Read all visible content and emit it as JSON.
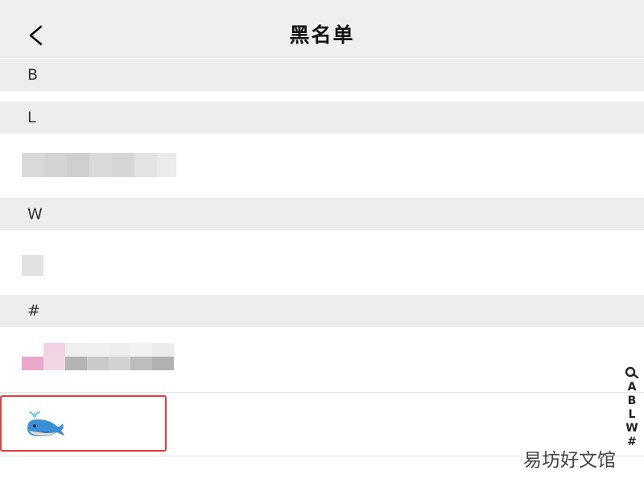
{
  "header": {
    "title": "黑名单",
    "back_icon": "chevron-left-icon"
  },
  "sections": [
    {
      "letter": "B"
    },
    {
      "letter": "L"
    },
    {
      "letter": "W"
    },
    {
      "letter": "#"
    }
  ],
  "index_bar": {
    "search_icon": "search-icon",
    "letters": [
      "A",
      "B",
      "L",
      "W",
      "#"
    ]
  },
  "highlighted_item": {
    "avatar_icon": "whale-emoji-icon"
  },
  "watermark": "易坊好文馆",
  "colors": {
    "header_bg": "#efefef",
    "section_bg": "#ededed",
    "highlight_border": "#e23c3c"
  }
}
